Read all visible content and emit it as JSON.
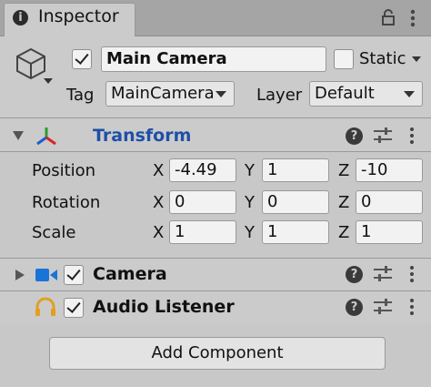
{
  "window": {
    "tab_title": "Inspector",
    "tab_icon_glyph": "i"
  },
  "object": {
    "active": true,
    "name": "Main Camera",
    "static_checked": false,
    "static_label": "Static",
    "tag_label": "Tag",
    "tag_value": "MainCamera",
    "layer_label": "Layer",
    "layer_value": "Default"
  },
  "transform": {
    "title": "Transform",
    "title_color": "#1f4fa8",
    "rows": [
      {
        "label": "Position",
        "x": "-4.49",
        "y": "1",
        "z": "-10"
      },
      {
        "label": "Rotation",
        "x": "0",
        "y": "0",
        "z": "0"
      },
      {
        "label": "Scale",
        "x": "1",
        "y": "1",
        "z": "1"
      }
    ],
    "axis_labels": {
      "x": "X",
      "y": "Y",
      "z": "Z"
    }
  },
  "components": [
    {
      "name": "Camera",
      "enabled": true,
      "icon": "camera-icon",
      "icon_color": "#1a73d9"
    },
    {
      "name": "Audio Listener",
      "enabled": true,
      "icon": "headphones-icon",
      "icon_color": "#e0a020"
    }
  ],
  "footer": {
    "add_component_label": "Add Component"
  },
  "help_glyph": "?"
}
